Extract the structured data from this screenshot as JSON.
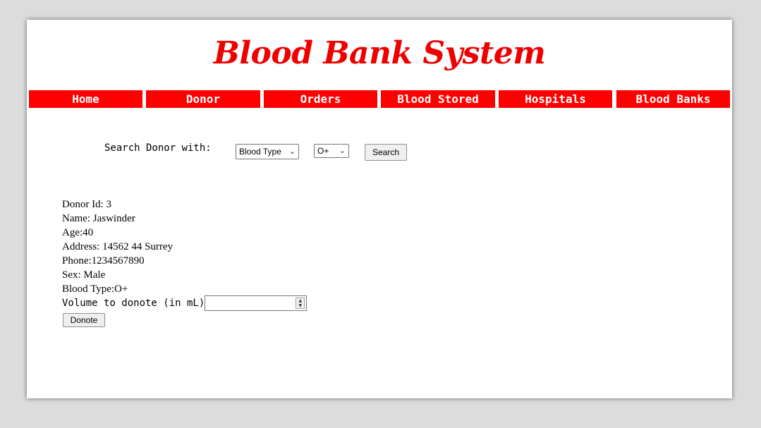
{
  "header": {
    "title": "Blood Bank System"
  },
  "nav": {
    "items": [
      "Home",
      "Donor",
      "Orders",
      "Blood Stored",
      "Hospitals",
      "Blood Banks"
    ],
    "color": "#ff0000"
  },
  "search": {
    "label": "Search Donor with:",
    "field_select": "Blood Type",
    "value_select": "O+",
    "button": "Search"
  },
  "donor": {
    "id": "Donor Id: 3",
    "name": "Name: Jaswinder",
    "age": "Age:40",
    "address": "Address: 14562 44 Surrey",
    "phone": "Phone:1234567890",
    "sex": "Sex: Male",
    "blood_type": "Blood Type:O+"
  },
  "donate": {
    "label": "Volume to donote (in mL)",
    "value": "",
    "button": "Donote"
  }
}
